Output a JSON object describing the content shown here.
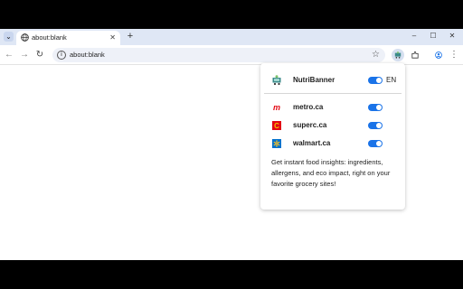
{
  "browser": {
    "tab_search_glyph": "⌄",
    "tab_title": "about:blank",
    "tab_close_glyph": "✕",
    "new_tab_glyph": "+",
    "minimize_glyph": "–",
    "maximize_glyph": "☐",
    "close_glyph": "✕",
    "back_glyph": "←",
    "forward_glyph": "→",
    "reload_glyph": "↻",
    "info_glyph": "i",
    "url": "about:blank",
    "star_glyph": "☆",
    "menu_glyph": "⋮",
    "accent": "#1a73e8"
  },
  "popup": {
    "header": {
      "label": "NutriBanner",
      "enabled": true,
      "language": "EN"
    },
    "sites": [
      {
        "label": "metro.ca",
        "icon": "metro-logo-icon",
        "color": "#e30613",
        "enabled": true
      },
      {
        "label": "superc.ca",
        "icon": "superc-logo-icon",
        "color": "#f5a300",
        "enabled": true
      },
      {
        "label": "walmart.ca",
        "icon": "walmart-logo-icon",
        "color": "#0071ce",
        "enabled": true
      }
    ],
    "description": "Get instant food insights: ingredients, allergens, and eco impact, right on your favorite grocery sites!"
  }
}
